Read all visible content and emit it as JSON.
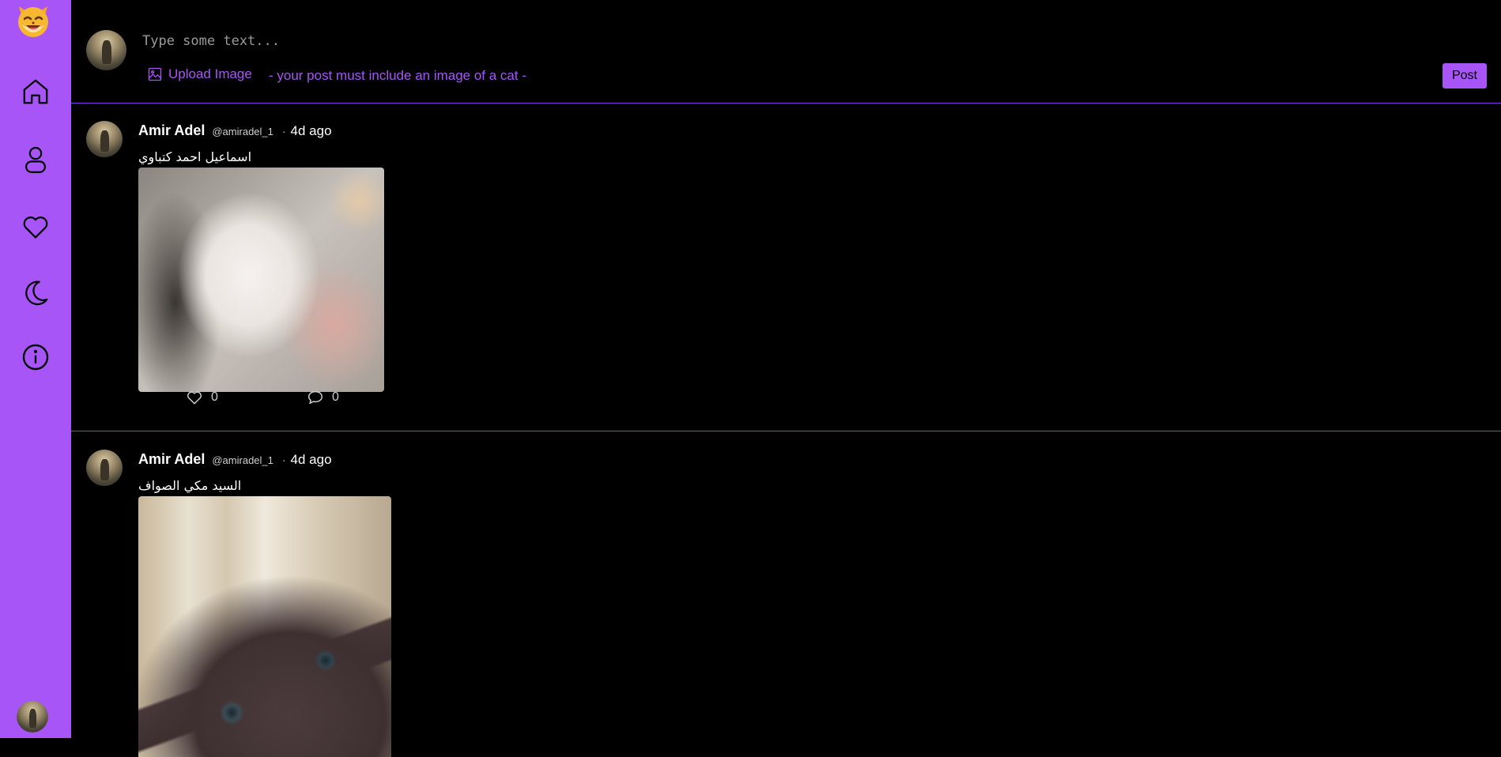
{
  "app": {
    "logo": "cat-face-emoji",
    "accent_color": "#a855f7"
  },
  "sidebar": {
    "items": [
      {
        "name": "home",
        "icon": "home-icon"
      },
      {
        "name": "profile",
        "icon": "user-icon"
      },
      {
        "name": "likes",
        "icon": "heart-icon"
      },
      {
        "name": "theme",
        "icon": "moon-icon"
      },
      {
        "name": "about",
        "icon": "info-icon"
      }
    ]
  },
  "composer": {
    "placeholder": "Type some text...",
    "upload_label": "Upload Image",
    "notice": "- your post must include an image of a cat -",
    "post_label": "Post"
  },
  "posts": [
    {
      "author": "Amir Adel",
      "handle": "@amiradel_1",
      "separator": "·",
      "time": "4d ago",
      "text": "اسماعيل احمد كتباوي",
      "likes": "0",
      "comments": "0"
    },
    {
      "author": "Amir Adel",
      "handle": "@amiradel_1",
      "separator": "·",
      "time": "4d ago",
      "text": "السيد مكي الصواف"
    }
  ]
}
